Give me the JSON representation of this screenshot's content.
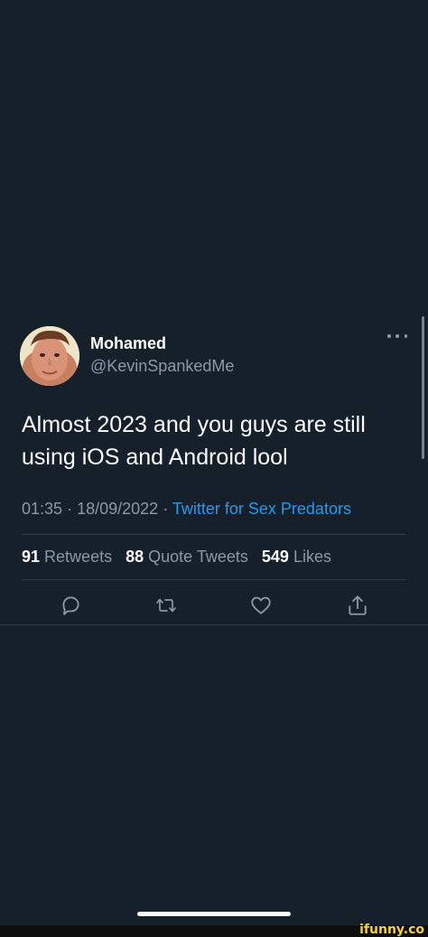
{
  "tweet": {
    "author": {
      "name": "Mohamed",
      "handle": "@KevinSpankedMe"
    },
    "text": "Almost 2023 and you guys are still using iOS and Android lool",
    "time": "01:35",
    "separator": "·",
    "date": "18/09/2022",
    "source": "Twitter for Sex Predators",
    "stats": {
      "retweets_count": "91",
      "retweets_label": "Retweets",
      "quotes_count": "88",
      "quotes_label": "Quote Tweets",
      "likes_count": "549",
      "likes_label": "Likes"
    },
    "actions": [
      {
        "icon": "reply-icon"
      },
      {
        "icon": "retweet-icon"
      },
      {
        "icon": "like-icon"
      },
      {
        "icon": "share-icon"
      }
    ]
  },
  "watermark": "ifunny.co",
  "colors": {
    "background": "#16202b",
    "text_primary": "#ffffff",
    "text_secondary": "#8b98a5",
    "link": "#1d9bf0",
    "watermark": "#f6d32d"
  }
}
